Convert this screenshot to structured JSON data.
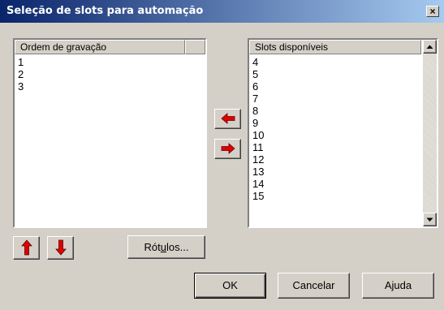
{
  "dialog": {
    "title": "Seleção de slots para automação",
    "close_glyph": "×"
  },
  "left_list": {
    "header": "Ordem de gravação",
    "items": [
      "1",
      "2",
      "3"
    ]
  },
  "right_list": {
    "header": "Slots disponíveis",
    "items": [
      "4",
      "5",
      "6",
      "7",
      "8",
      "9",
      "10",
      "11",
      "12",
      "13",
      "14",
      "15"
    ]
  },
  "icons": {
    "move_left": "arrow-left-icon",
    "move_right": "arrow-right-icon",
    "move_up": "arrow-up-icon",
    "move_down": "arrow-down-icon",
    "scroll_up": "scroll-up-icon",
    "scroll_down": "scroll-down-icon",
    "arrow_color": "#e00000"
  },
  "buttons": {
    "labels_pre": "Rót",
    "labels_mnemonic": "u",
    "labels_post": "los...",
    "ok": "OK",
    "cancel": "Cancelar",
    "help": "Ajuda"
  }
}
